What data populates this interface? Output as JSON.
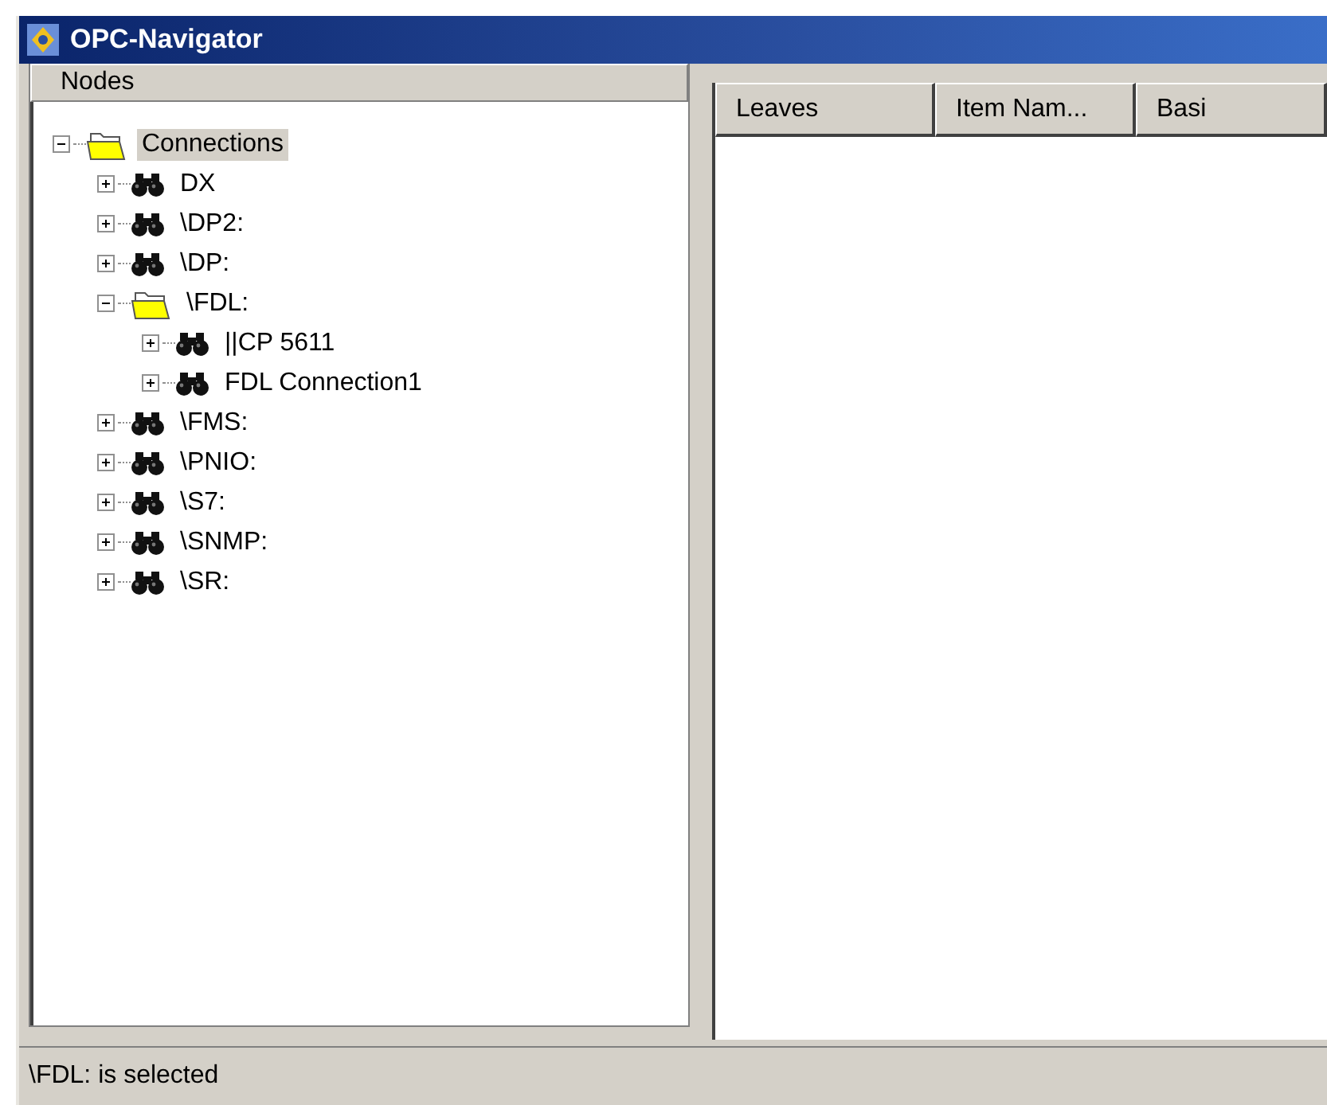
{
  "window": {
    "title": "OPC-Navigator"
  },
  "nodes_panel": {
    "header": "Nodes",
    "tree": [
      {
        "label": "Connections",
        "kind": "folder",
        "expanded": true,
        "selected": true,
        "children": [
          {
            "label": "DX",
            "kind": "binoculars",
            "expanded": false,
            "selected": false
          },
          {
            "label": "\\DP2:",
            "kind": "binoculars",
            "expanded": false,
            "selected": false
          },
          {
            "label": "\\DP:",
            "kind": "binoculars",
            "expanded": false,
            "selected": false
          },
          {
            "label": "\\FDL:",
            "kind": "folder",
            "expanded": true,
            "selected": false,
            "children": [
              {
                "label": "||CP 5611",
                "kind": "binoculars",
                "expanded": false,
                "selected": false
              },
              {
                "label": "FDL Connection1",
                "kind": "binoculars",
                "expanded": false,
                "selected": false
              }
            ]
          },
          {
            "label": "\\FMS:",
            "kind": "binoculars",
            "expanded": false,
            "selected": false
          },
          {
            "label": "\\PNIO:",
            "kind": "binoculars",
            "expanded": false,
            "selected": false
          },
          {
            "label": "\\S7:",
            "kind": "binoculars",
            "expanded": false,
            "selected": false
          },
          {
            "label": "\\SNMP:",
            "kind": "binoculars",
            "expanded": false,
            "selected": false
          },
          {
            "label": "\\SR:",
            "kind": "binoculars",
            "expanded": false,
            "selected": false
          }
        ]
      }
    ]
  },
  "leaves_panel": {
    "columns": [
      "Leaves",
      "Item Nam...",
      "Basi"
    ]
  },
  "status_bar": "\\FDL: is selected"
}
